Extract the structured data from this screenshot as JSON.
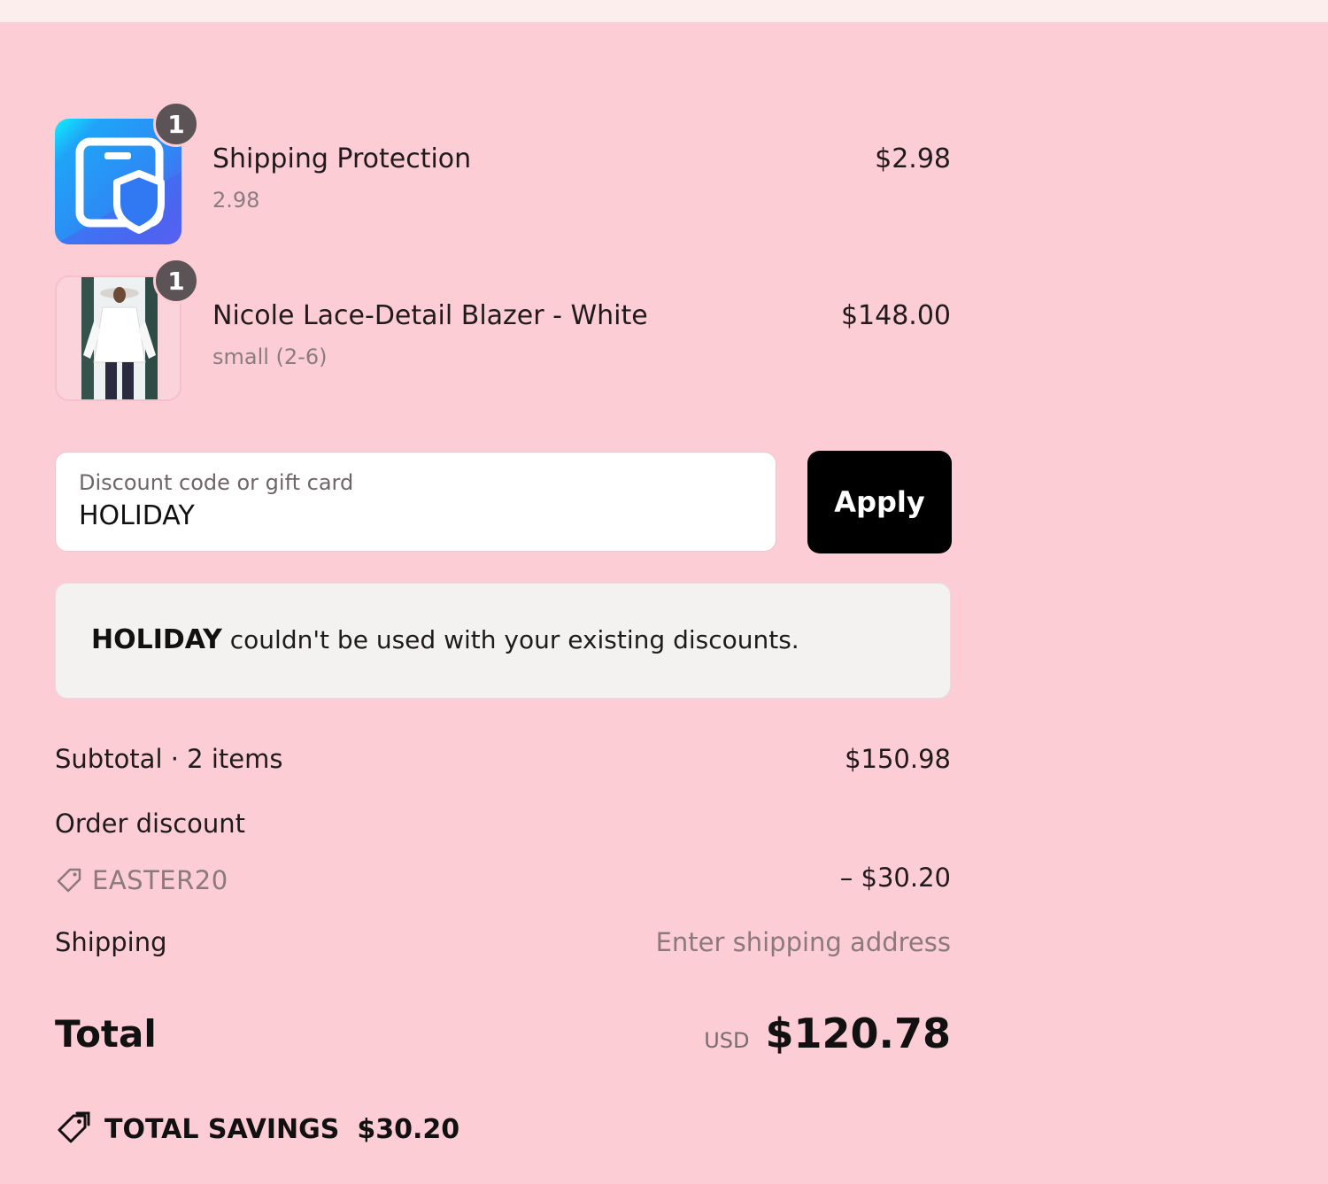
{
  "line_items": [
    {
      "title": "Shipping Protection",
      "subtitle": "2.98",
      "price": "$2.98",
      "quantity": "1",
      "image": "shipping-protection-shield-icon"
    },
    {
      "title": "Nicole Lace-Detail Blazer - White",
      "subtitle": "small (2-6)",
      "price": "$148.00",
      "quantity": "1",
      "image": "blazer-product-photo"
    }
  ],
  "discount": {
    "label": "Discount code or gift card",
    "value": "HOLIDAY",
    "apply_label": "Apply"
  },
  "alert": {
    "code": "HOLIDAY",
    "message": "couldn't be used with your existing discounts."
  },
  "totals": {
    "subtotal_label": "Subtotal · 2 items",
    "subtotal_value": "$150.98",
    "order_discount_label": "Order discount",
    "discount_code": "EASTER20",
    "discount_value": "– $30.20",
    "shipping_label": "Shipping",
    "shipping_value": "Enter shipping address",
    "total_label": "Total",
    "currency": "USD",
    "total_value": "$120.78",
    "savings_label": "TOTAL SAVINGS",
    "savings_value": "$30.20"
  },
  "colors": {
    "background": "#fdcdd6",
    "button": "#000000",
    "alert_background": "#f3f2f1",
    "badge": "#5b5355"
  }
}
